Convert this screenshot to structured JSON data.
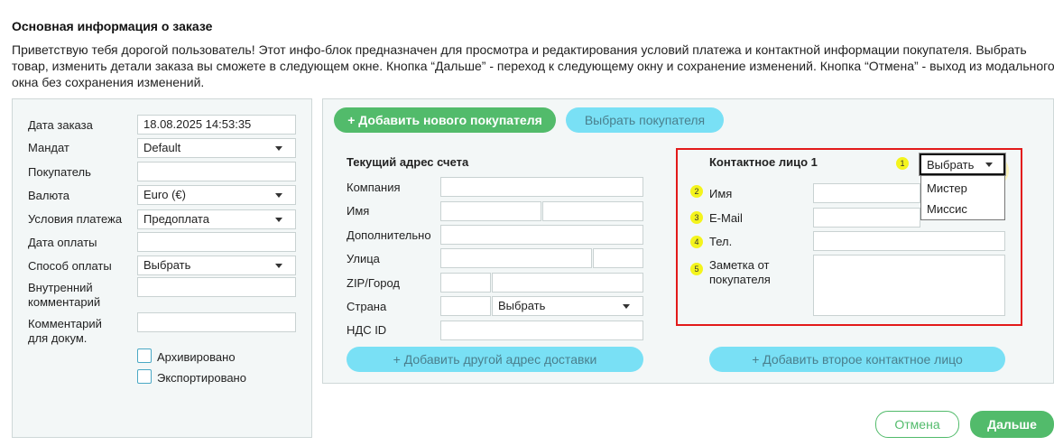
{
  "header": {
    "title": "Основная информация о заказе",
    "intro": "Приветствую тебя дорогой пользователь! Этот инфо-блок предназначен для просмотра и редактирования условий платежа и контактной информации покупателя. Выбрать товар, изменить детали заказа вы сможете в следующем окне. Кнопка “Дальше” - переход к следующему окну и сохранение изменений. Кнопка “Отмена” - выход из модального окна без сохранения изменений."
  },
  "left": {
    "order_date": {
      "label": "Дата заказа",
      "value": "18.08.2025 14:53:35"
    },
    "mandate": {
      "label": "Мандат",
      "value": "Default"
    },
    "buyer": {
      "label": "Покупатель",
      "value": ""
    },
    "currency": {
      "label": "Валюта",
      "value": "Euro (€)"
    },
    "payment_terms": {
      "label": "Условия платежа",
      "value": "Предоплата"
    },
    "payment_date": {
      "label": "Дата оплаты",
      "value": ""
    },
    "payment_method": {
      "label": "Способ оплаты",
      "value": "Выбрать"
    },
    "internal_comment": {
      "label_1": "Внутренний",
      "label_2": "комментарий",
      "value": ""
    },
    "doc_comment": {
      "label_1": "Комментарий",
      "label_2": "для докум.",
      "value": ""
    },
    "archived": {
      "label": "Архивировано",
      "checked": false
    },
    "exported": {
      "label": "Экспортировано",
      "checked": false
    }
  },
  "right": {
    "add_buyer_button": "+ Добавить нового покупателя",
    "select_buyer_button": "Выбрать покупателя",
    "billing": {
      "title": "Текущий адрес счета",
      "company": "Компания",
      "name": "Имя",
      "additional": "Дополнительно",
      "street": "Улица",
      "zip_city": "ZIP/Город",
      "country": "Страна",
      "country_value": "Выбрать",
      "vat_id": "НДС ID"
    },
    "add_delivery_button": "+ Добавить другой адрес доставки",
    "contact": {
      "title": "Контактное лицо 1",
      "salutation_value": "Выбрать",
      "salutation_options": [
        "Мистер",
        "Миссис"
      ],
      "name": "Имя",
      "email": "E-Mail",
      "phone": "Тел.",
      "note_1": "Заметка от",
      "note_2": "покупателя",
      "badges": [
        "1",
        "2",
        "3",
        "4",
        "5"
      ]
    },
    "add_contact_button": "+ Добавить второе контактное лицо"
  },
  "footer": {
    "cancel": "Отмена",
    "next": "Дальше"
  },
  "colors": {
    "green": "#52bb6b",
    "light_blue": "#79e0f5",
    "highlight_red": "#e21a1a",
    "badge_yellow": "#f4f41c"
  }
}
